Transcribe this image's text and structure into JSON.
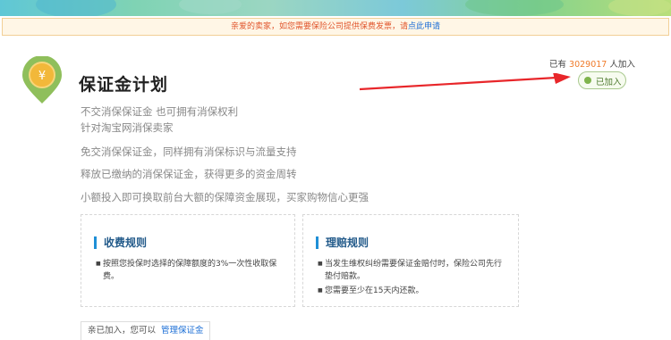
{
  "notice": {
    "text": "亲爱的卖家，如您需要保险公司提供保费发票，请",
    "link": "点此申请"
  },
  "plan": {
    "title": "保证金计划",
    "subtitle_line1": "不交消保保证金 也可拥有消保权利",
    "subtitle_line2": "针对淘宝网消保卖家",
    "features": [
      "免交消保保证金，同样拥有消保标识与流量支持",
      "释放已缴纳的消保保证金，获得更多的资金周转",
      "小额投入即可换取前台大额的保障资金展现，买家购物信心更强"
    ]
  },
  "join": {
    "prefix": "已有",
    "count": "3029017",
    "suffix": "人加入",
    "button_label": "已加入"
  },
  "fee_rules": {
    "title": "收费规则",
    "items": [
      "按照您投保时选择的保障额度的3%一次性收取保费。"
    ]
  },
  "claim_rules": {
    "title": "理赔规则",
    "items": [
      "当发生维权纠纷需要保证金赔付时，保险公司先行垫付赔款。",
      "您需要至少在15天内还款。"
    ]
  },
  "footer": {
    "text": "亲已加入，您可以",
    "link": "管理保证金"
  },
  "colors": {
    "accent_link": "#1c6fd6",
    "count_orange": "#f07b2b",
    "arrow_red": "#e8262a",
    "joined_green": "#7fb44c"
  },
  "icons": {
    "logo": "yuan-location-pin-icon",
    "arrow": "red-arrow-pointer"
  }
}
